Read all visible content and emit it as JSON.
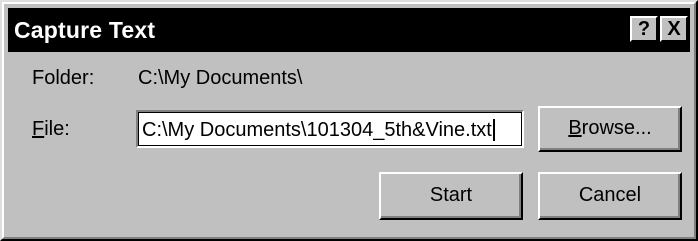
{
  "window": {
    "title": "Capture Text",
    "help_label": "?",
    "close_label": "X"
  },
  "form": {
    "folder_label": "Folder:",
    "folder_value": "C:\\My Documents\\",
    "file_label_mnemonic": "F",
    "file_label_rest": "ile:",
    "file_value": "C:\\My Documents\\101304_5th&Vine.txt"
  },
  "buttons": {
    "browse_mnemonic": "B",
    "browse_rest": "rowse...",
    "start_label": "Start",
    "cancel_label": "Cancel"
  }
}
